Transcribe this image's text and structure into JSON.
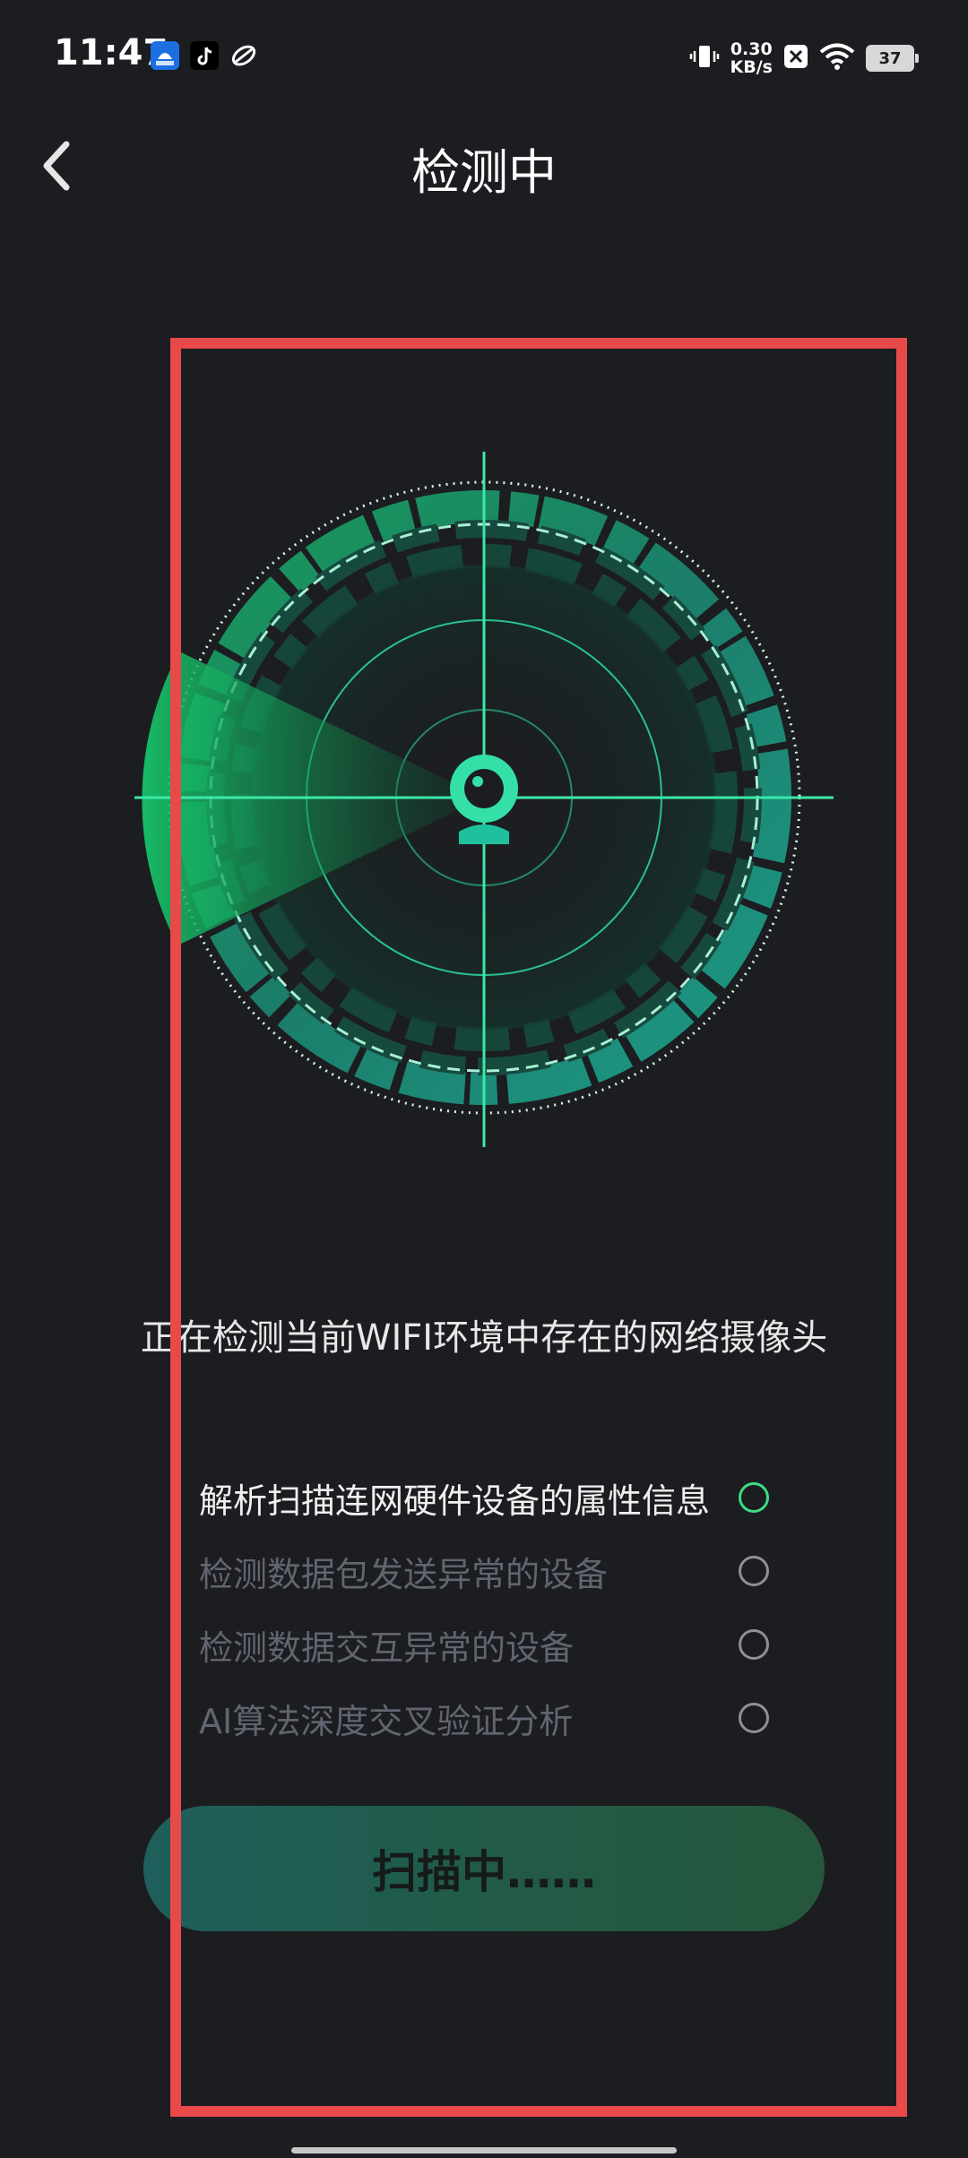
{
  "status_bar": {
    "time": "11:47",
    "net_speed_value": "0.30",
    "net_speed_unit": "KB/s",
    "battery": "37",
    "icons": [
      "app-icon-blue",
      "tiktok-icon",
      "app-icon-leaf",
      "vibrate-icon",
      "close-box-icon",
      "wifi-icon",
      "battery-icon"
    ]
  },
  "header": {
    "title": "检测中",
    "back_icon": "chevron-left-icon"
  },
  "radar": {
    "center_icon": "camera-icon",
    "accent_color": "#3ddc84",
    "teal_color": "#1dbf9f"
  },
  "detect_description": "正在检测当前WIFI环境中存在的网络摄像头",
  "steps": [
    {
      "label": "解析扫描连网硬件设备的属性信息",
      "state": "active"
    },
    {
      "label": "检测数据包发送异常的设备",
      "state": "pending"
    },
    {
      "label": "检测数据交互异常的设备",
      "state": "pending"
    },
    {
      "label": "AI算法深度交叉验证分析",
      "state": "pending"
    }
  ],
  "scan_button": {
    "label": "扫描中……"
  },
  "colors": {
    "background": "#1c1d21",
    "highlight_frame": "#e84a4a",
    "active_step": "#3ddc84",
    "inactive_text": "#626470"
  }
}
